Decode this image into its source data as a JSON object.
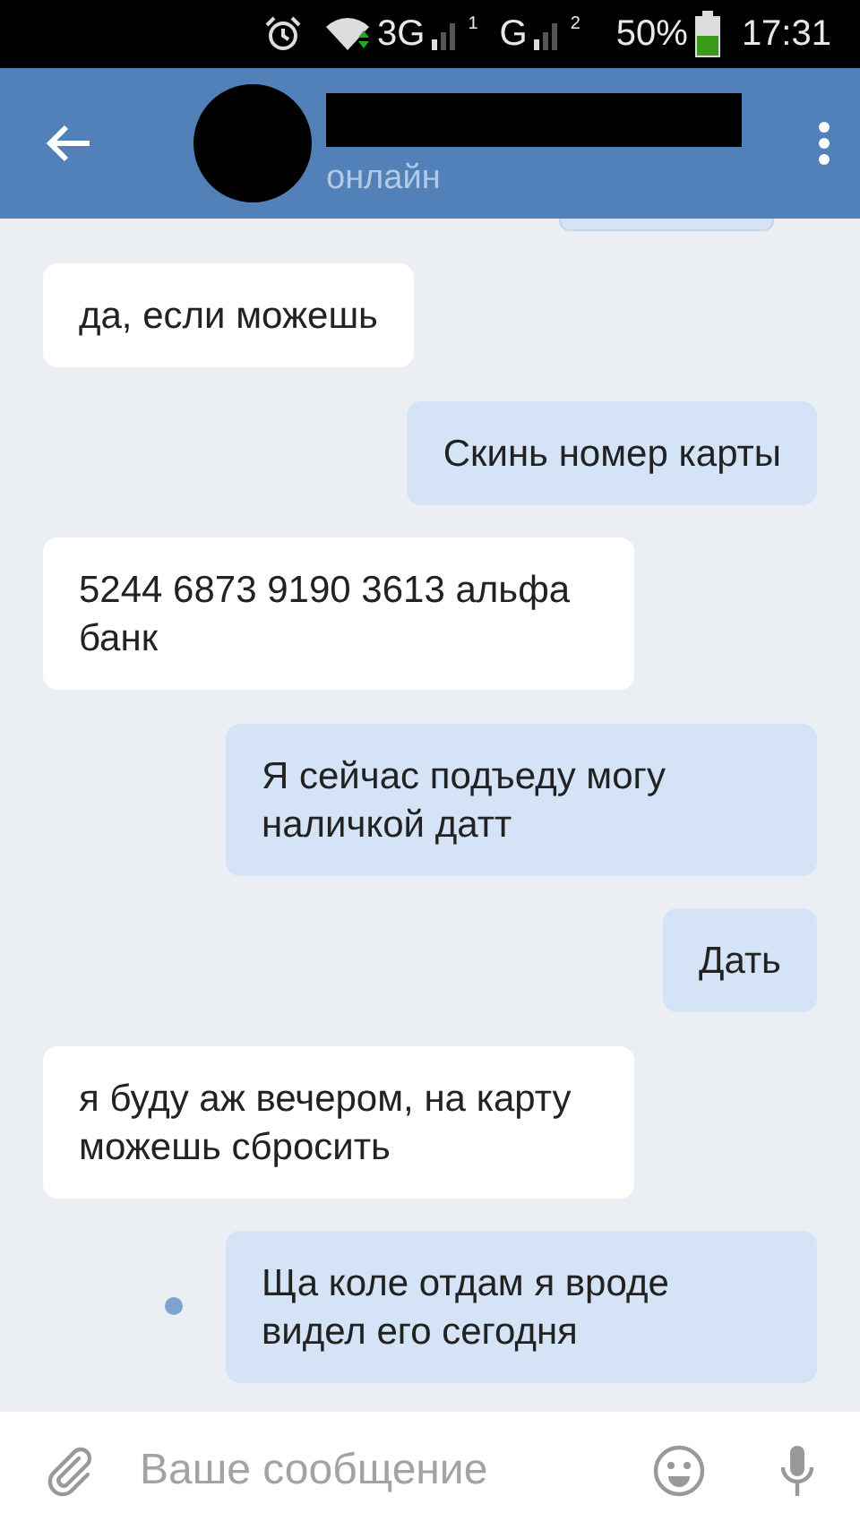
{
  "status_bar": {
    "network": "3G",
    "sim_1": "1",
    "network_2": "G",
    "sim_2": "2",
    "battery": "50%",
    "time": "17:31"
  },
  "header": {
    "status": "онлайн"
  },
  "messages": [
    {
      "kind": "clipped"
    },
    {
      "kind": "in",
      "text": "да, если можешь",
      "unread": false
    },
    {
      "kind": "out",
      "text": "Скинь номер карты",
      "unread": false
    },
    {
      "kind": "in",
      "text": "5244 6873 9190 3613 альфа банк",
      "unread": false
    },
    {
      "kind": "out",
      "text": "Я сейчас подъеду могу наличкой датт",
      "unread": false
    },
    {
      "kind": "out",
      "text": "Дать",
      "unread": false
    },
    {
      "kind": "in",
      "text": "я буду аж вечером, на карту можешь сбросить",
      "unread": false
    },
    {
      "kind": "out",
      "text": "Ща коле отдам я вроде видел его сегодня",
      "unread": true
    }
  ],
  "composer": {
    "placeholder": "Ваше сообщение"
  }
}
